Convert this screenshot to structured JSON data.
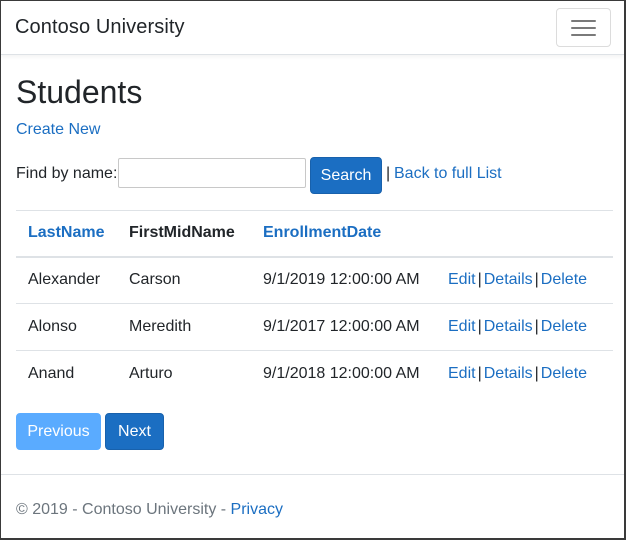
{
  "navbar": {
    "brand": "Contoso University",
    "toggler_icon": "hamburger-menu-icon"
  },
  "page": {
    "title": "Students",
    "create_new_label": "Create New"
  },
  "search": {
    "label": "Find by name:",
    "value": "",
    "placeholder": "",
    "button_label": "Search",
    "separator": "|",
    "back_link_label": "Back to full List"
  },
  "table": {
    "headers": {
      "last_name": "LastName",
      "first_mid_name": "FirstMidName",
      "enrollment_date": "EnrollmentDate"
    },
    "rows": [
      {
        "last_name": "Alexander",
        "first_mid_name": "Carson",
        "enrollment_date": "9/1/2019 12:00:00 AM",
        "edit": "Edit",
        "details": "Details",
        "delete": "Delete"
      },
      {
        "last_name": "Alonso",
        "first_mid_name": "Meredith",
        "enrollment_date": "9/1/2017 12:00:00 AM",
        "edit": "Edit",
        "details": "Details",
        "delete": "Delete"
      },
      {
        "last_name": "Anand",
        "first_mid_name": "Arturo",
        "enrollment_date": "9/1/2018 12:00:00 AM",
        "edit": "Edit",
        "details": "Details",
        "delete": "Delete"
      }
    ],
    "action_separator": "|"
  },
  "pager": {
    "previous_label": "Previous",
    "previous_disabled": true,
    "next_label": "Next"
  },
  "footer": {
    "copyright": "© 2019 - Contoso University - ",
    "privacy_label": "Privacy"
  },
  "colors": {
    "primary": "#1b6ec2",
    "primary_disabled": "#5aabff",
    "link": "#1b6ec2",
    "muted_text": "#6c757d",
    "border": "#dee2e6"
  }
}
